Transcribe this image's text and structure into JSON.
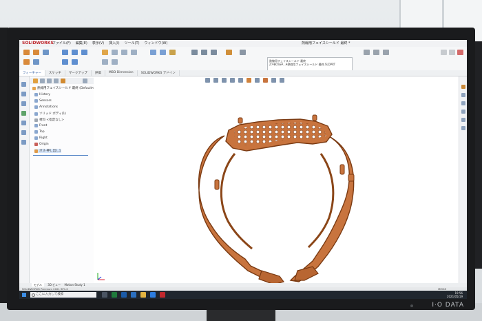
{
  "app": {
    "logo_text": "SOLIDWORKS",
    "window_title": "熱線用フェイスシールド 最終 *"
  },
  "menu": [
    "ファイル(F)",
    "編集(E)",
    "表示(V)",
    "挿入(I)",
    "ツール(T)",
    "ウィンドウ(W)"
  ],
  "command_tabs": [
    "フィーチャー",
    "スケッチ",
    "マークアップ",
    "評価",
    "MBD Dimension",
    "SOLIDWORKS アドイン"
  ],
  "tooltip": {
    "title": "熱線用フェイスシールド 最終",
    "body": "Z:¥BOSS¥...¥熱線用フェイスシールド 最終.SLDPRT"
  },
  "feature_tree": {
    "root": "熱線用フェイスシールド 最終 (Default<<...",
    "items": [
      "History",
      "Sensors",
      "Annotations",
      "ソリッド ボディ(1)",
      "材料 <指定なし>",
      "Front",
      "Top",
      "Right",
      "Origin",
      "ボス-押し出し1"
    ]
  },
  "bottom_tabs": [
    "モデル",
    "3D ビュー",
    "Motion Study 1"
  ],
  "status": {
    "left": "SOLIDWORKS Premium 2021 SP1.0",
    "right": "MMGS"
  },
  "taskbar": {
    "search_placeholder": "ここに入力して検索",
    "time": "19:56",
    "date": "2021/05/19"
  },
  "monitor_brand": "I·O DATA",
  "colors": {
    "model": "#c8743e",
    "model_edge": "#7a3a12",
    "accent": "#2c5aa0",
    "taskbar": "#20262e"
  }
}
